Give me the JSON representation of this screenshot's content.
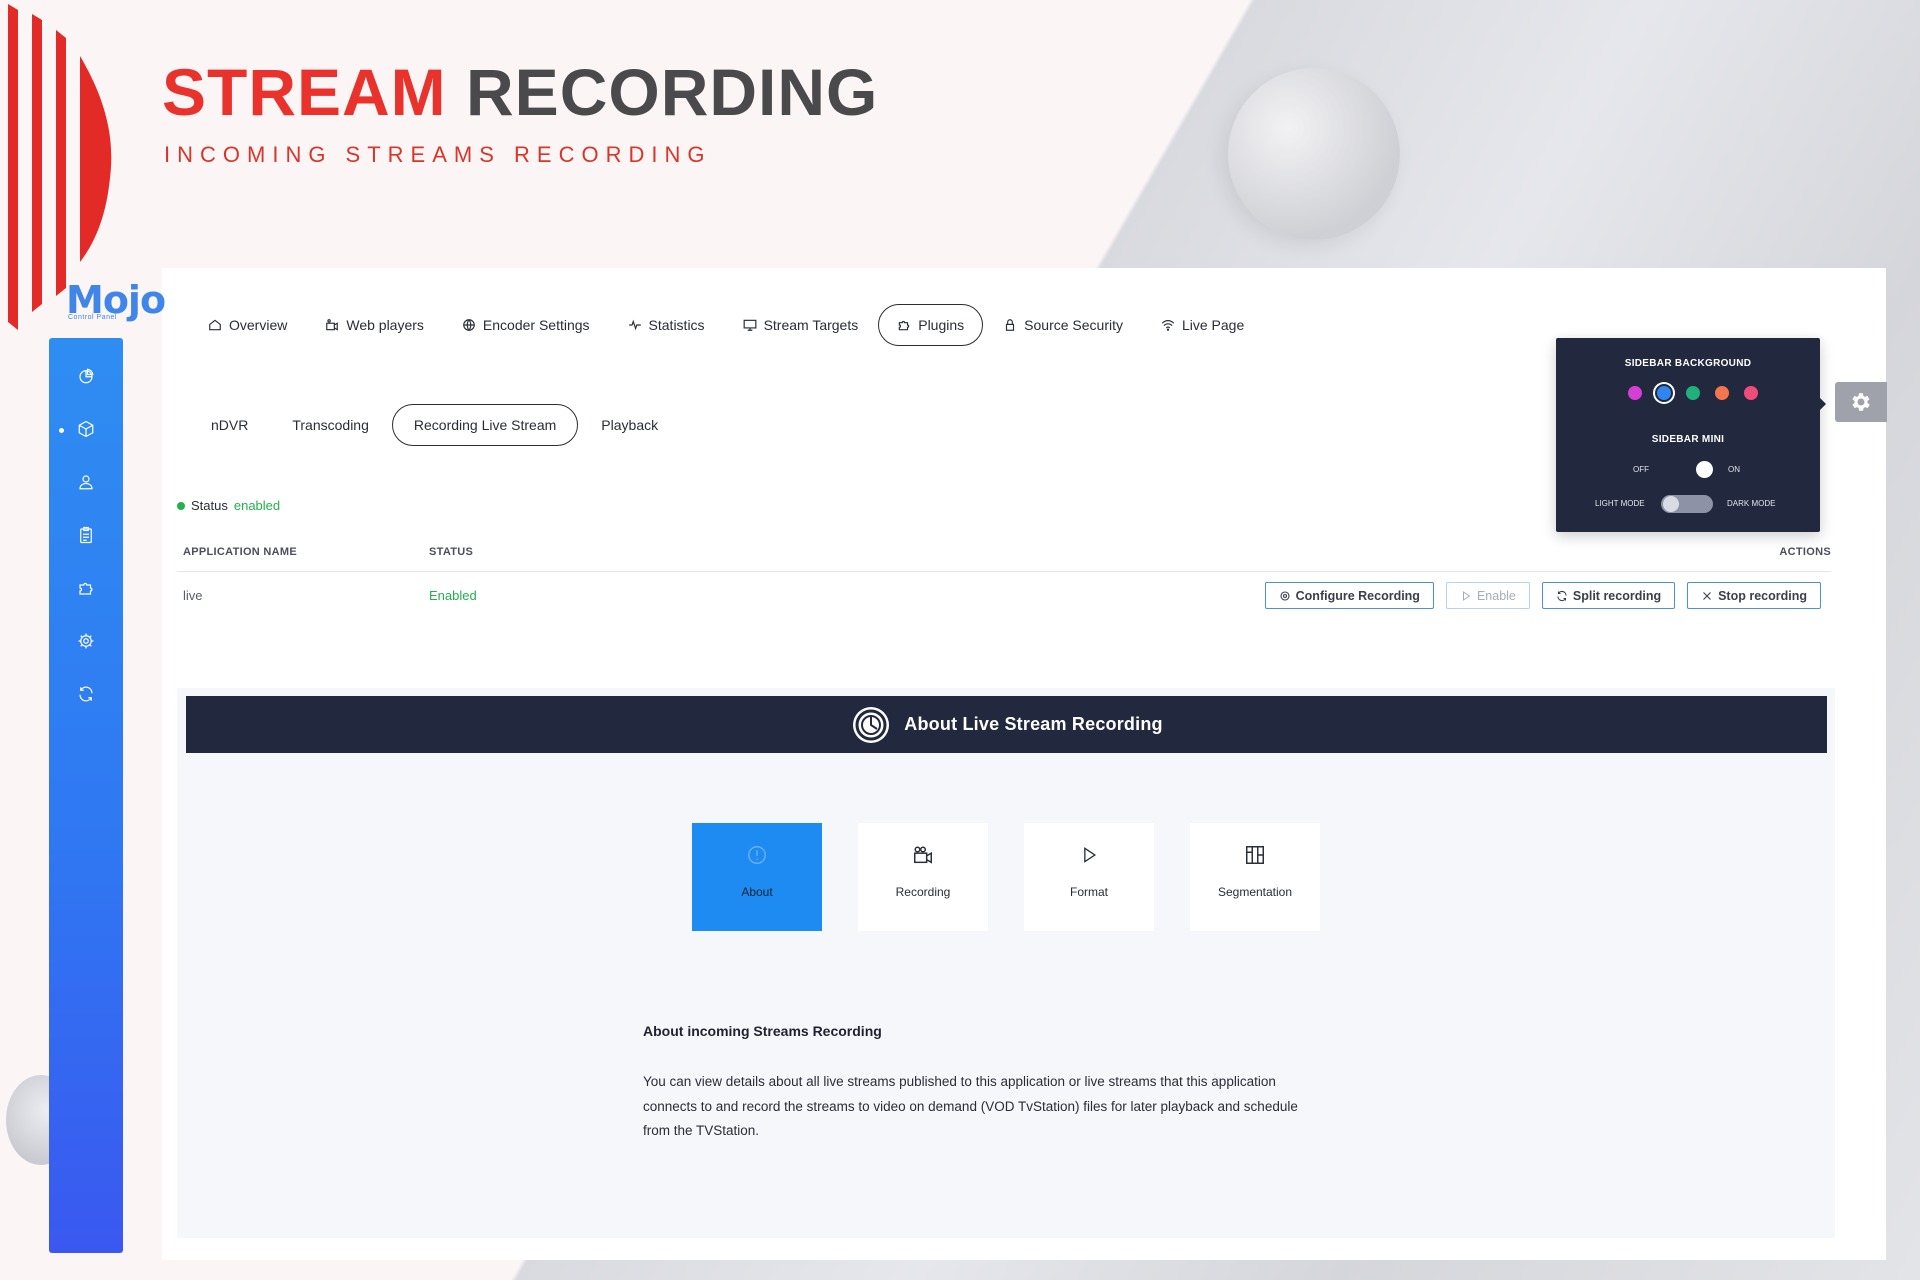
{
  "hero": {
    "title_red": "STREAM",
    "title_grey": "RECORDING",
    "subtitle": "INCOMING STREAMS RECORDING"
  },
  "brand": {
    "logo": "Mojo",
    "logo_sub": "Control Panel",
    "accent": "#2f8df2",
    "red": "#e8322b"
  },
  "sidebar": {
    "icons": [
      "dashboard-icon",
      "cube-icon",
      "user-icon",
      "clipboard-icon",
      "puzzle-icon",
      "gear-icon",
      "refresh-icon"
    ]
  },
  "topnav": {
    "items": [
      {
        "label": "Overview",
        "icon": "home-icon"
      },
      {
        "label": "Web players",
        "icon": "player-icon"
      },
      {
        "label": "Encoder Settings",
        "icon": "globe-icon"
      },
      {
        "label": "Statistics",
        "icon": "pulse-icon"
      },
      {
        "label": "Stream Targets",
        "icon": "monitor-icon"
      },
      {
        "label": "Plugins",
        "icon": "puzzle-icon",
        "active": true
      },
      {
        "label": "Source Security",
        "icon": "lock-icon"
      },
      {
        "label": "Live Page",
        "icon": "wifi-icon"
      }
    ]
  },
  "subnav": {
    "items": [
      {
        "label": "nDVR"
      },
      {
        "label": "Transcoding"
      },
      {
        "label": "Recording Live Stream",
        "active": true
      },
      {
        "label": "Playback"
      }
    ]
  },
  "status": {
    "prefix": "Status",
    "value": "enabled"
  },
  "table": {
    "headers": {
      "app_name": "APPLICATION NAME",
      "status": "STATUS",
      "actions": "ACTIONS"
    },
    "rows": [
      {
        "app_name": "live",
        "status": "Enabled",
        "actions": {
          "configure": "Configure Recording",
          "enable": "Enable",
          "split": "Split recording",
          "stop": "Stop recording"
        }
      }
    ]
  },
  "about": {
    "bar_title": "About Live Stream Recording",
    "tiles": [
      {
        "label": "About",
        "icon": "info-icon",
        "active": true
      },
      {
        "label": "Recording",
        "icon": "camera-icon"
      },
      {
        "label": "Format",
        "icon": "play-icon"
      },
      {
        "label": "Segmentation",
        "icon": "segments-icon"
      }
    ],
    "heading": "About incoming Streams Recording",
    "body": "You can view details about all live streams published to this application or live streams that this application connects to and record the streams to video on demand (VOD TvStation) files for later playback and schedule from the TVStation."
  },
  "settings_panel": {
    "sidebar_background": "SIDEBAR BACKGROUND",
    "swatches": [
      "#d63fd6",
      "#2f86f0",
      "#20b07a",
      "#f4754d",
      "#ef4c7a"
    ],
    "sidebar_mini": "SIDEBAR MINI",
    "off": "OFF",
    "on": "ON",
    "light_mode": "LIGHT MODE",
    "dark_mode": "DARK MODE"
  }
}
